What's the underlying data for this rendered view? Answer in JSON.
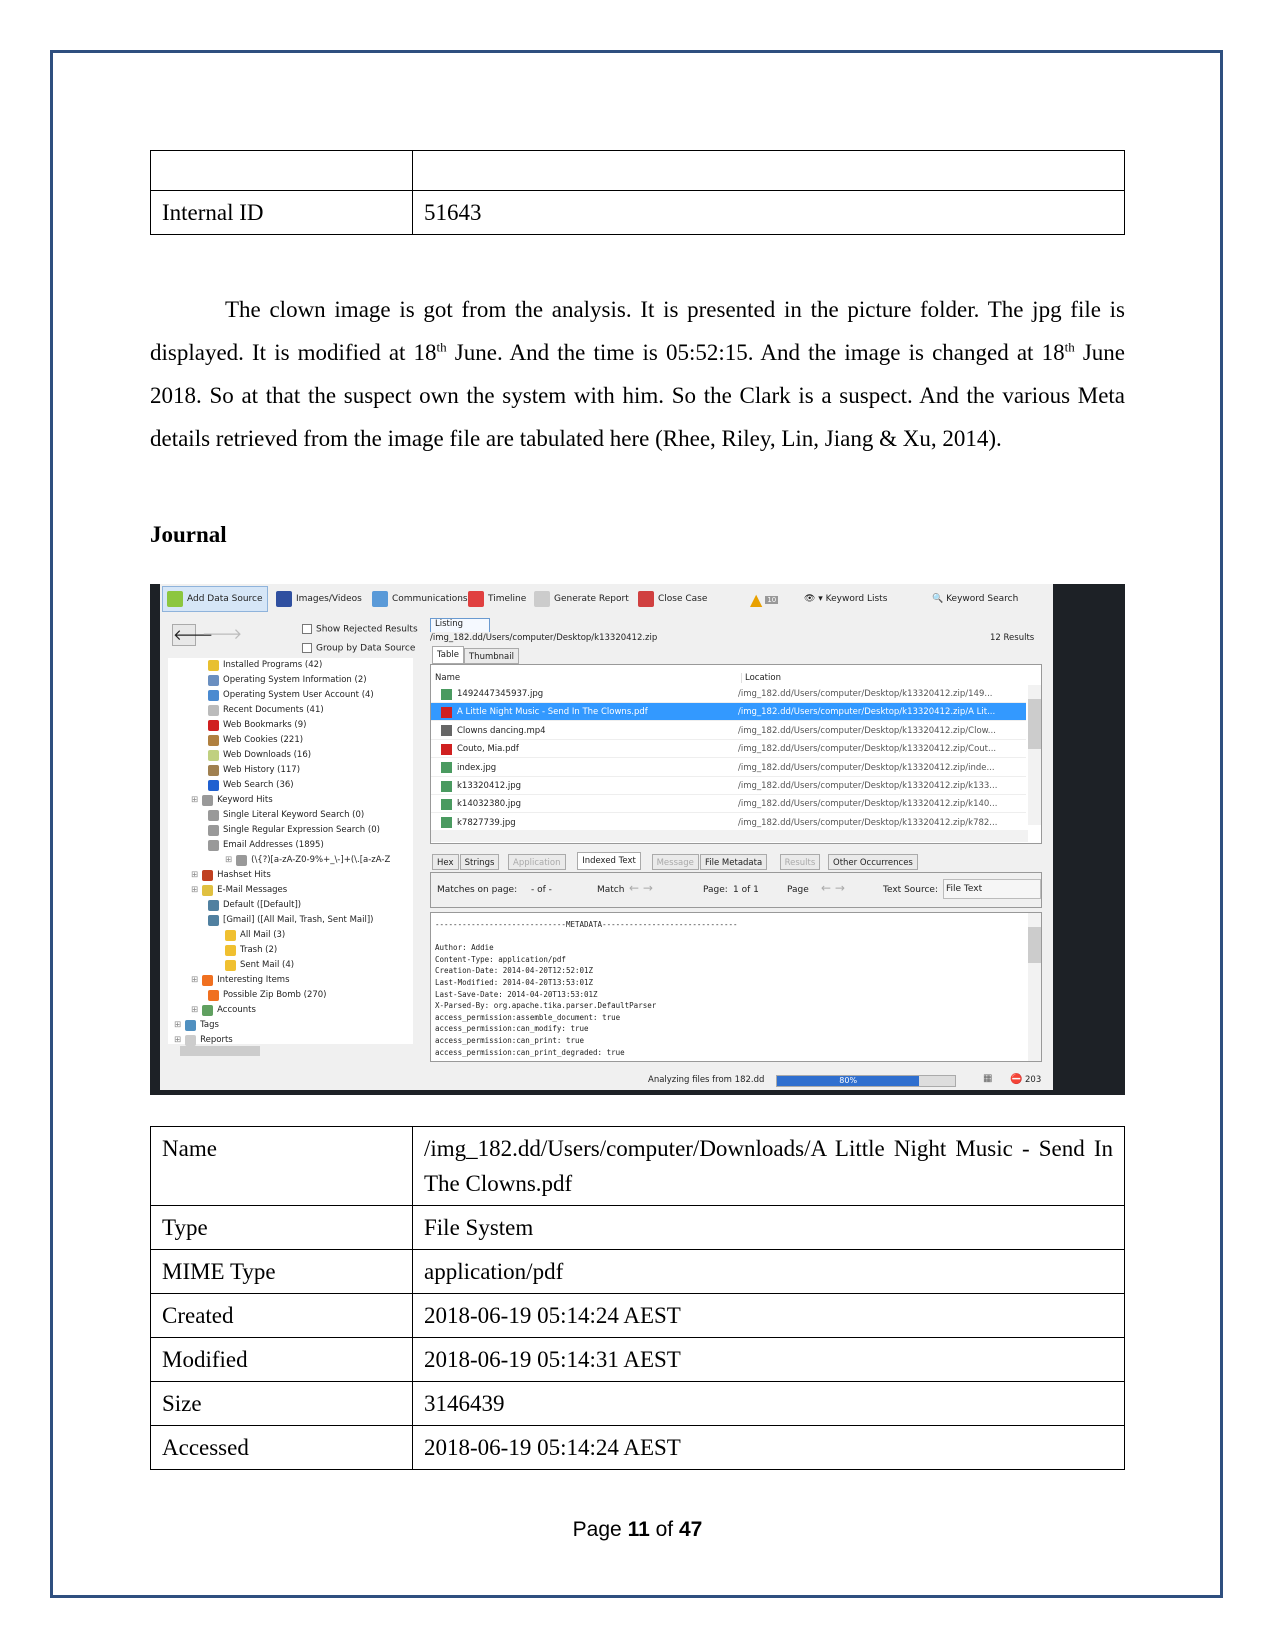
{
  "table1": {
    "rows": [
      [
        "",
        ""
      ],
      [
        "Internal ID",
        "51643"
      ]
    ]
  },
  "paragraph": {
    "s1": "The clown image is got from the analysis. It is presented in the picture folder. The jpg file is displayed. It is modified at 18",
    "sup1": "th",
    "s2": " June. And the time is 05:52:15. And the image is changed at 18",
    "sup2": "th",
    "s3": " June 2018. So at that the suspect own the system with him. So the Clark is a suspect. And the various Meta details retrieved from the image file are tabulated here (Rhee, Riley, Lin, Jiang & Xu, 2014)."
  },
  "heading": "Journal",
  "app": {
    "toolbar": [
      {
        "label": "Add Data Source",
        "icon": "plus-icon"
      },
      {
        "label": "Images/Videos",
        "icon": "images-icon"
      },
      {
        "label": "Communications",
        "icon": "communications-icon"
      },
      {
        "label": "Timeline",
        "icon": "timeline-icon"
      },
      {
        "label": "Generate Report",
        "icon": "report-icon"
      },
      {
        "label": "Close Case",
        "icon": "close-case-icon"
      }
    ],
    "alert_count": "10",
    "keyword_lists": "Keyword Lists",
    "keyword_search": "Keyword Search",
    "show_rejected": "Show Rejected Results",
    "group_by": "Group by Data Source",
    "tree": [
      {
        "label": "Installed Programs (42)",
        "lvl": 2,
        "c": "#e8c030"
      },
      {
        "label": "Operating System Information (2)",
        "lvl": 2,
        "c": "#6a8fc0"
      },
      {
        "label": "Operating System User Account (4)",
        "lvl": 2,
        "c": "#4a8ad0"
      },
      {
        "label": "Recent Documents (41)",
        "lvl": 2,
        "c": "#bbb"
      },
      {
        "label": "Web Bookmarks (9)",
        "lvl": 2,
        "c": "#d02020"
      },
      {
        "label": "Web Cookies (221)",
        "lvl": 2,
        "c": "#b08040"
      },
      {
        "label": "Web Downloads (16)",
        "lvl": 2,
        "c": "#c0d080"
      },
      {
        "label": "Web History (117)",
        "lvl": 2,
        "c": "#a08050"
      },
      {
        "label": "Web Search (36)",
        "lvl": 2,
        "c": "#2060d0"
      },
      {
        "label": "Keyword Hits",
        "lvl": 1,
        "c": "#999"
      },
      {
        "label": "Single Literal Keyword Search (0)",
        "lvl": 2,
        "c": "#999"
      },
      {
        "label": "Single Regular Expression Search (0)",
        "lvl": 2,
        "c": "#999"
      },
      {
        "label": "Email Addresses (1895)",
        "lvl": 2,
        "c": "#999"
      },
      {
        "label": "(\\{?)[a-zA-Z0-9%+_\\-]+(\\.[a-zA-Z",
        "lvl": 3,
        "c": "#999"
      },
      {
        "label": "Hashset Hits",
        "lvl": 1,
        "c": "#c04020"
      },
      {
        "label": "E-Mail Messages",
        "lvl": 1,
        "c": "#e0c040"
      },
      {
        "label": "Default ([Default])",
        "lvl": 2,
        "c": "#5080a0"
      },
      {
        "label": "[Gmail] ([All Mail, Trash, Sent Mail])",
        "lvl": 2,
        "c": "#5080a0"
      },
      {
        "label": "All Mail (3)",
        "lvl": 3,
        "c": "#f0c030"
      },
      {
        "label": "Trash (2)",
        "lvl": 3,
        "c": "#f0c030"
      },
      {
        "label": "Sent Mail (4)",
        "lvl": 3,
        "c": "#f0c030"
      },
      {
        "label": "Interesting Items",
        "lvl": 1,
        "c": "#f07020"
      },
      {
        "label": "Possible Zip Bomb (270)",
        "lvl": 2,
        "c": "#f07020"
      },
      {
        "label": "Accounts",
        "lvl": 1,
        "c": "#60a060"
      },
      {
        "label": "Tags",
        "lvl": 0,
        "c": "#5090c0"
      },
      {
        "label": "Reports",
        "lvl": 0,
        "c": "#ccc"
      }
    ],
    "listing_tab": "Listing",
    "path": "/img_182.dd/Users/computer/Desktop/k13320412.zip",
    "results": "12 Results",
    "view_tabs": [
      "Table",
      "Thumbnail"
    ],
    "columns": [
      "Name",
      "Location"
    ],
    "files": [
      {
        "name": "1492447345937.jpg",
        "loc": "/img_182.dd/Users/computer/Desktop/k13320412.zip/149...",
        "t": "img"
      },
      {
        "name": "A Little Night Music - Send In The Clowns.pdf",
        "loc": "/img_182.dd/Users/computer/Desktop/k13320412.zip/A Lit...",
        "t": "pdf",
        "sel": true
      },
      {
        "name": "Clowns dancing.mp4",
        "loc": "/img_182.dd/Users/computer/Desktop/k13320412.zip/Clow...",
        "t": "vid"
      },
      {
        "name": "Couto, Mia.pdf",
        "loc": "/img_182.dd/Users/computer/Desktop/k13320412.zip/Cout...",
        "t": "pdf"
      },
      {
        "name": "index.jpg",
        "loc": "/img_182.dd/Users/computer/Desktop/k13320412.zip/inde...",
        "t": "img"
      },
      {
        "name": "k13320412.jpg",
        "loc": "/img_182.dd/Users/computer/Desktop/k13320412.zip/k133...",
        "t": "img"
      },
      {
        "name": "k14032380.jpg",
        "loc": "/img_182.dd/Users/computer/Desktop/k13320412.zip/k140...",
        "t": "img"
      },
      {
        "name": "k7827739.jpg",
        "loc": "/img_182.dd/Users/computer/Desktop/k13320412.zip/k782...",
        "t": "img"
      }
    ],
    "content_tabs": [
      {
        "label": "Hex"
      },
      {
        "label": "Strings"
      },
      {
        "label": "Application",
        "disabled": true
      },
      {
        "label": "Indexed Text",
        "active": true
      },
      {
        "label": "Message",
        "disabled": true
      },
      {
        "label": "File Metadata"
      },
      {
        "label": "Results",
        "disabled": true
      },
      {
        "label": "Other Occurrences"
      }
    ],
    "matches_label": "Matches on page:",
    "matches_value": "-   of   -",
    "match_label": "Match",
    "page_label": "Page:",
    "page_value": "1  of  1",
    "page2_label": "Page",
    "text_source_label": "Text Source:",
    "text_source_value": "File Text",
    "metadata": "-----------------------------METADATA------------------------------\n\nAuthor: Addie\nContent-Type: application/pdf\nCreation-Date: 2014-04-20T12:52:01Z\nLast-Modified: 2014-04-20T13:53:01Z\nLast-Save-Date: 2014-04-20T13:53:01Z\nX-Parsed-By: org.apache.tika.parser.DefaultParser\naccess_permission:assemble_document: true\naccess_permission:can_modify: true\naccess_permission:can_print: true\naccess_permission:can_print_degraded: true",
    "status": "Analyzing files from 182.dd",
    "progress_percent": 80,
    "progress_label": "80%",
    "error_count": "203",
    "colors": {
      "selection": "#3399ff",
      "progress": "#2f6fcf"
    }
  },
  "table2": {
    "rows": [
      [
        "Name",
        "/img_182.dd/Users/computer/Downloads/A Little Night Music - Send In The Clowns.pdf"
      ],
      [
        "Type",
        "File System"
      ],
      [
        "MIME Type",
        "application/pdf"
      ],
      [
        "Created",
        "2018-06-19 05:14:24 AEST"
      ],
      [
        "Modified",
        "2018-06-19 05:14:31 AEST"
      ],
      [
        "Size",
        "3146439"
      ],
      [
        "Accessed",
        "2018-06-19 05:14:24 AEST"
      ]
    ]
  },
  "footer": {
    "prefix": "Page ",
    "page": "11",
    "mid": " of ",
    "total": "47"
  }
}
